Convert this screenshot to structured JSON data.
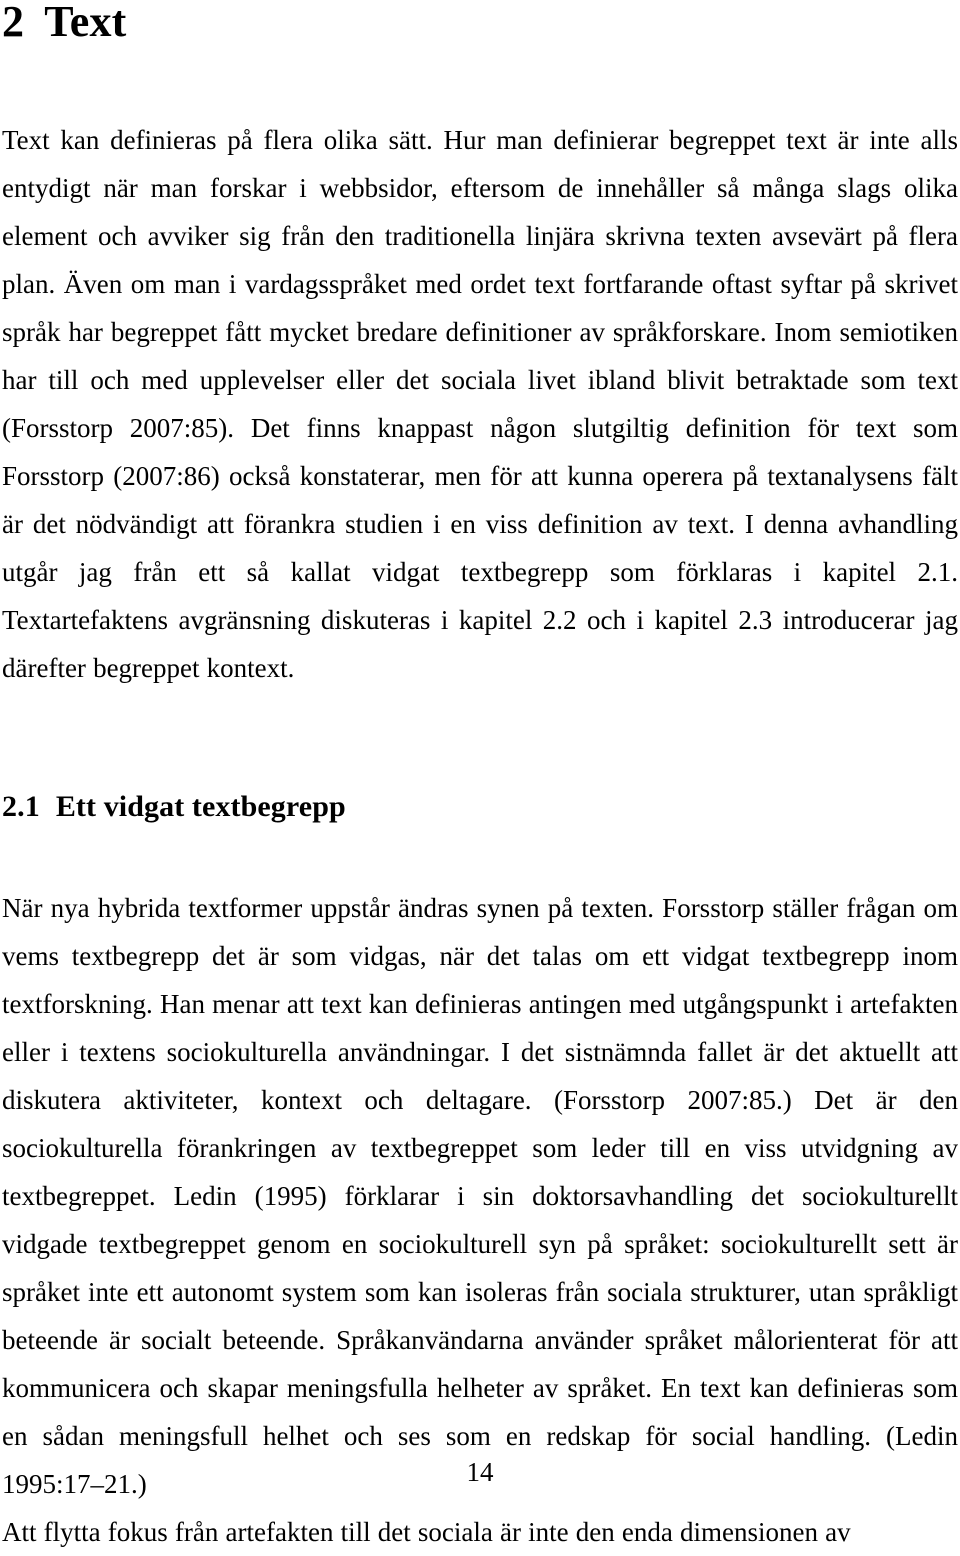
{
  "document": {
    "language": "sv",
    "page_number": "14"
  },
  "chapter": {
    "number": "2",
    "title": "Text"
  },
  "paragraphs": {
    "intro": "Text kan definieras på flera olika sätt. Hur man definierar begreppet text är inte alls entydigt när man forskar i webbsidor, eftersom de innehåller så många slags olika element och avviker sig från den traditionella linjära skrivna texten avsevärt på flera plan. Även om man i vardagsspråket med ordet text fortfarande oftast syftar på skrivet språk har begreppet fått mycket bredare definitioner av språkforskare. Inom semiotiken har till och med upplevelser eller det sociala livet ibland blivit betraktade som text (Forsstorp 2007:85). Det finns knappast någon slutgiltig definition för text som Forsstorp (2007:86) också konstaterar, men för att kunna operera på textanalysens fält är det nödvändigt att förankra studien i en viss definition av text. I denna avhandling utgår jag från ett så kallat vidgat textbegrepp som förklaras i kapitel 2.1. Textartefaktens avgränsning diskuteras i kapitel 2.2 och i kapitel 2.3 introducerar jag därefter begreppet kontext.",
    "section_body": "När nya hybrida textformer uppstår ändras synen på texten. Forsstorp ställer frågan om vems textbegrepp det är som vidgas, när det talas om ett vidgat textbegrepp inom textforskning. Han menar att text kan definieras antingen med utgångspunkt i artefakten eller i textens sociokulturella användningar. I det sistnämnda fallet är det aktuellt att diskutera aktiviteter, kontext och deltagare. (Forsstorp 2007:85.) Det är den sociokulturella förankringen av textbegreppet som leder till en viss utvidgning av textbegreppet. Ledin (1995) förklarar i sin doktorsavhandling det sociokulturellt vidgade textbegreppet genom en sociokulturell syn på språket: sociokulturellt sett är språket inte ett autonomt system som kan isoleras från sociala strukturer, utan språkligt beteende är socialt beteende. Språkanvändarna använder språket målorienterat för att kommunicera och skapar meningsfulla helheter av språket. En text kan definieras som en sådan meningsfull helhet och ses som en redskap för social handling. (Ledin 1995:17–21.)",
    "next_par_start": "Att flytta fokus från artefakten till det sociala är inte den enda dimensionen av"
  },
  "section": {
    "number": "2.1",
    "title": "Ett vidgat textbegrepp"
  }
}
